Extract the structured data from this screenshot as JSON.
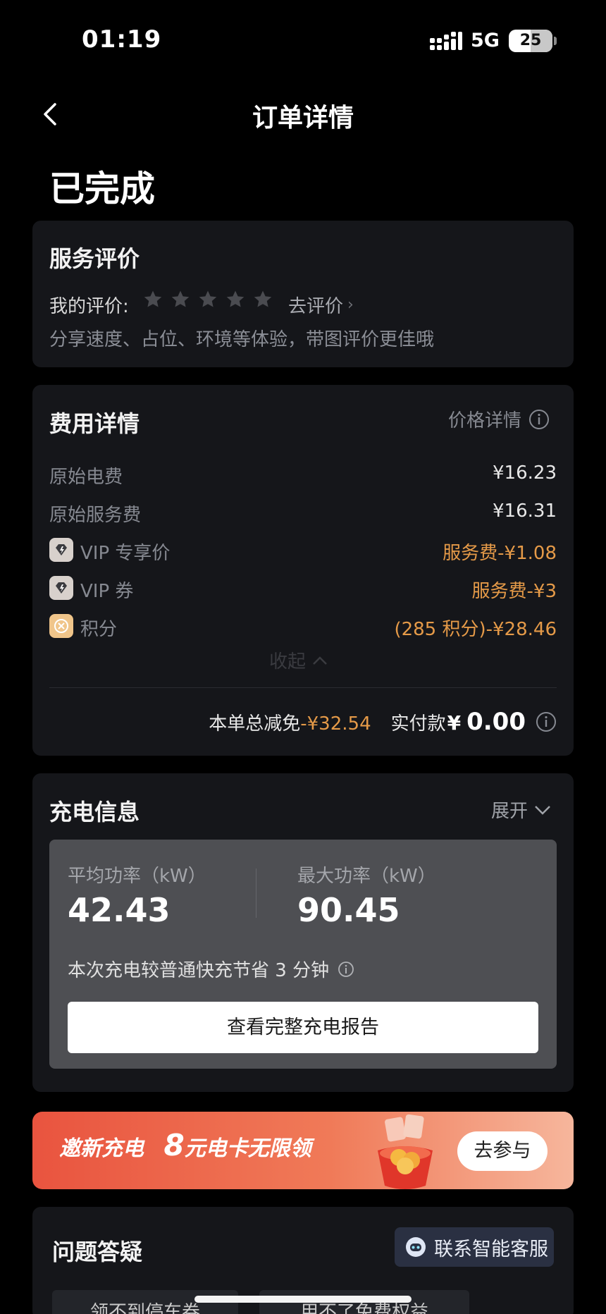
{
  "status_bar": {
    "time": "01:19",
    "network": "5G",
    "battery": "25"
  },
  "nav": {
    "title": "订单详情"
  },
  "order": {
    "status": "已完成"
  },
  "review": {
    "title": "服务评价",
    "my_rating_label": "我的评价:",
    "stars": 5,
    "rate_link": "去评价",
    "hint": "分享速度、占位、环境等体验，带图评价更佳哦"
  },
  "fees": {
    "title": "费用详情",
    "price_detail_link": "价格详情",
    "rows": [
      {
        "label": "原始电费",
        "value": "¥16.23"
      },
      {
        "label": "原始服务费",
        "value": "¥16.31"
      },
      {
        "label": "VIP 专享价",
        "value": "服务费-¥1.08",
        "icon": "vip-diamond-icon"
      },
      {
        "label": "VIP 券",
        "value": "服务费-¥3",
        "icon": "vip-diamond-icon"
      },
      {
        "label": "积分",
        "value": "(285 积分)-¥28.46",
        "icon": "points-icon"
      }
    ],
    "collapse_label": "收起",
    "total_discount_label": "本单总减免",
    "total_discount_value": "-¥32.54",
    "paid_label": "实付款",
    "paid_currency": "¥",
    "paid_value": "0.00"
  },
  "charging": {
    "title": "充电信息",
    "expand_label": "展开",
    "avg_power_label": "平均功率（kW）",
    "avg_power_value": "42.43",
    "max_power_label": "最大功率（kW）",
    "max_power_value": "90.45",
    "saving_note": "本次充电较普通快充节省 3 分钟",
    "report_button": "查看完整充电报告"
  },
  "banner": {
    "prefix": "邀新充电",
    "highlight": "8",
    "suffix": "元电卡无限领",
    "join_button": "去参与"
  },
  "faq": {
    "title": "问题答疑",
    "service_button": "联系智能客服",
    "chips": [
      "领不到停车券",
      "用不了免费权益"
    ]
  },
  "colors": {
    "background": "#000000",
    "card": "#15161a",
    "accent_orange": "#e59a48",
    "banner_red": "#e9543f"
  }
}
